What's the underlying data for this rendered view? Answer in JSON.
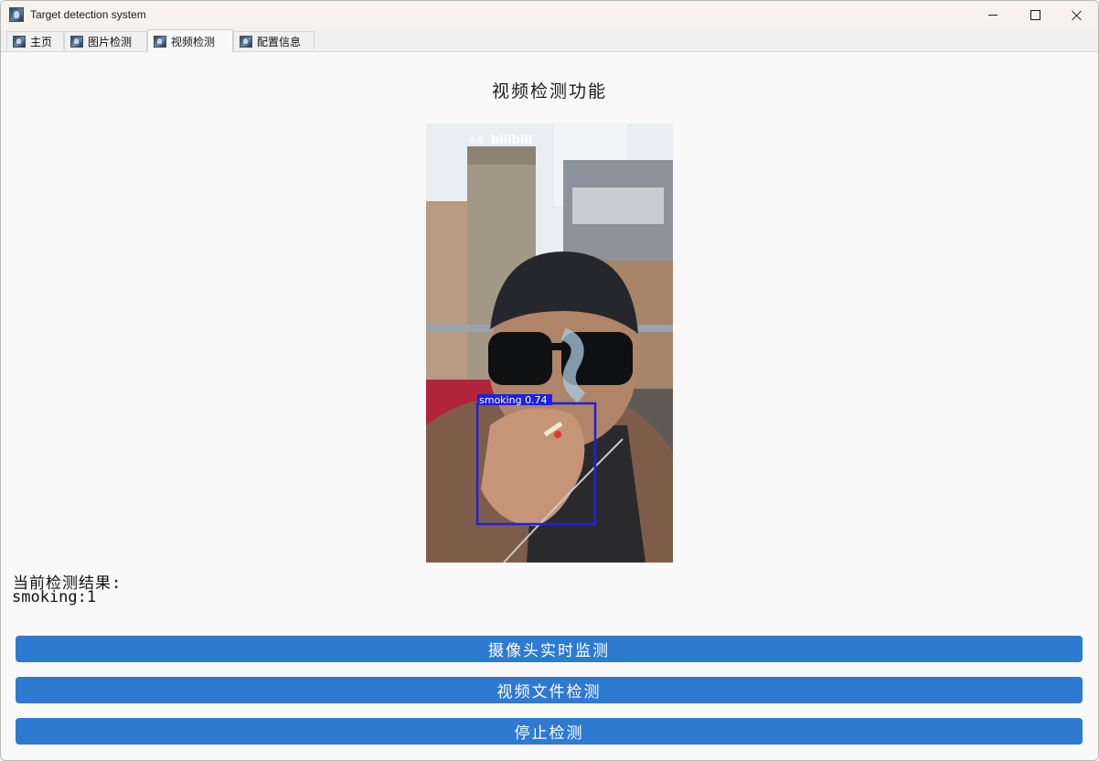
{
  "window": {
    "title": "Target detection system",
    "icons": {
      "app": "app-icon",
      "minimize": "minimize-icon",
      "maximize": "maximize-icon",
      "close": "close-icon"
    }
  },
  "tabs": [
    {
      "label": "主页",
      "icon": "app-tab-icon",
      "active": false
    },
    {
      "label": "图片检测",
      "icon": "app-tab-icon",
      "active": false
    },
    {
      "label": "视频检测",
      "icon": "app-tab-icon",
      "active": true
    },
    {
      "label": "配置信息",
      "icon": "app-tab-icon",
      "active": false
    }
  ],
  "main": {
    "title": "视频检测功能",
    "video": {
      "watermark": "大使",
      "watermark_brand": "bilibili",
      "detection": {
        "label": "smoking",
        "confidence": "0.74",
        "box_color": "#2020e0"
      }
    },
    "result_label": "当前检测结果:",
    "result_value": "smoking:1"
  },
  "buttons": {
    "camera": "摄像头实时监测",
    "file": "视频文件检测",
    "stop": "停止检测",
    "color": "#2f7ad1"
  }
}
